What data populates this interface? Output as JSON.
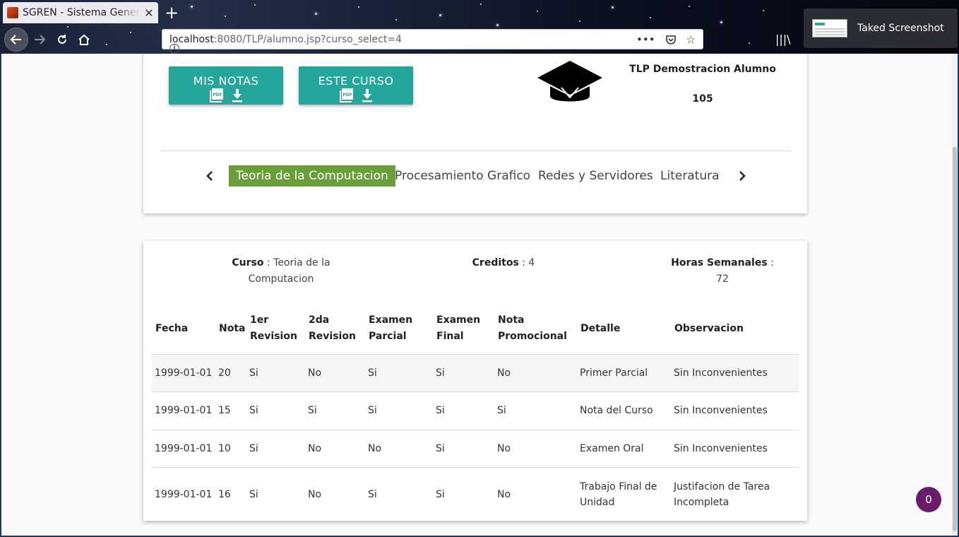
{
  "browser": {
    "tab_title": "SGREN - Sistema Generador",
    "url_host": "localhost",
    "url_rest": ":8080/TLP/alumno.jsp?curso_select=4",
    "notification_text": "Taked Screenshot",
    "page_actions_label": "•••"
  },
  "header": {
    "buttons": {
      "notas_label": "MIS NOTAS",
      "curso_label": "ESTE CURSO"
    },
    "student_name": "TLP Demostracion Alumno",
    "student_code": "105"
  },
  "courses": {
    "tabs": [
      {
        "label": "Teoria de la Computacion",
        "active": true
      },
      {
        "label": "Procesamiento Grafico",
        "active": false
      },
      {
        "label": "Redes y Servidores",
        "active": false
      },
      {
        "label": "Literatura",
        "active": false
      }
    ]
  },
  "course_info": {
    "curso_label": "Curso",
    "curso_value": "Teoria de la Computacion",
    "creditos_label": "Creditos",
    "creditos_value": "4",
    "horas_label": "Horas Semanales",
    "horas_value": "72"
  },
  "grades": {
    "columns": [
      "Fecha",
      "Nota",
      "1er Revision",
      "2da Revision",
      "Examen Parcial",
      "Examen Final",
      "Nota Promocional",
      "Detalle",
      "Observacion"
    ],
    "rows": [
      [
        "1999-01-01",
        "20",
        "Si",
        "No",
        "Si",
        "Si",
        "No",
        "Primer Parcial",
        "Sin Inconvenientes"
      ],
      [
        "1999-01-01",
        "15",
        "Si",
        "Si",
        "Si",
        "Si",
        "Si",
        "Nota del Curso",
        "Sin Inconvenientes"
      ],
      [
        "1999-01-01",
        "10",
        "Si",
        "No",
        "No",
        "Si",
        "No",
        "Examen Oral",
        "Sin Inconvenientes"
      ],
      [
        "1999-01-01",
        "16",
        "Si",
        "No",
        "Si",
        "Si",
        "No",
        "Trabajo Final de Unidad",
        "Justifacion de Tarea Incompleta"
      ]
    ]
  },
  "chat_badge": "0",
  "colors": {
    "accent": "#26a69a",
    "active_tab": "#689f38",
    "badge": "#6a1b6a"
  }
}
